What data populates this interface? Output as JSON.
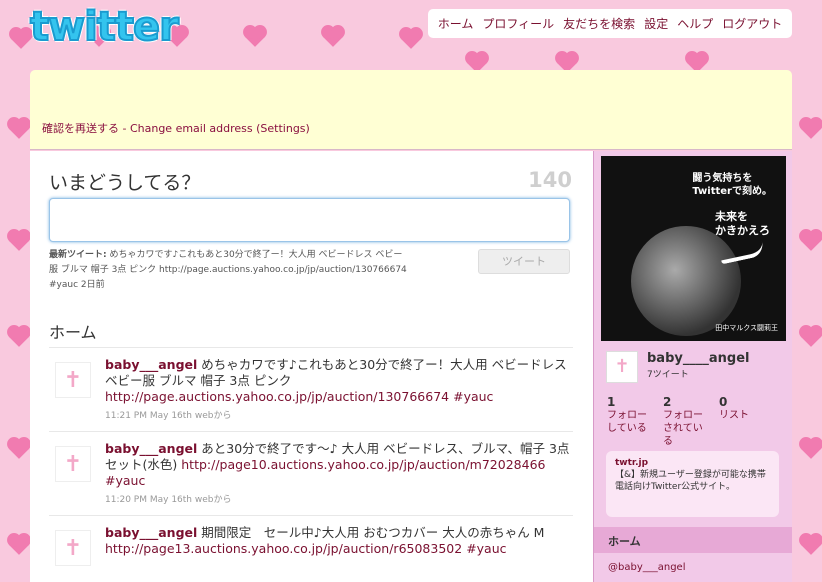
{
  "brand": {
    "logo_text": "twitter"
  },
  "topnav": [
    "ホーム",
    "プロフィール",
    "友だちを検索",
    "設定",
    "ヘルプ",
    "ログアウト"
  ],
  "notice": {
    "text": "確認を再送する - Change email address (Settings)"
  },
  "composer": {
    "prompt": "いまどうしてる？",
    "char_count": "140",
    "input_value": "",
    "latest_label": "最新ツイート:",
    "latest_text": "めちゃカワです♪これもあと30分で終了ー！大人用 ベビードレス ベビー服 ブルマ 帽子 3点 ピンク http://page.auctions.yahoo.co.jp/jp/auction/130766674 #yauc",
    "latest_time": "2日前",
    "tweet_button": "ツイート"
  },
  "timeline_title": "ホーム",
  "timeline": [
    {
      "user": "baby___angel",
      "text": "めちゃカワです♪これもあと30分で終了ー！大人用 ベビードレス ベビー服 ブルマ 帽子 3点 ピンク",
      "link": "http://page.auctions.yahoo.co.jp/jp/auction/130766674",
      "tag": "#yauc",
      "meta": "11:21 PM May 16th webから"
    },
    {
      "user": "baby___angel",
      "text": "あと30分で終了です〜♪ 大人用 ベビードレス、ブルマ、帽子 3点セット(水色)",
      "link": "http://page10.auctions.yahoo.co.jp/jp/auction/m72028466",
      "tag": "#yauc",
      "meta": "11:20 PM May 16th webから"
    },
    {
      "user": "baby___angel",
      "text": "期間限定　セール中♪大人用 おむつカバー 大人の赤ちゃん M",
      "link": "http://page13.auctions.yahoo.co.jp/jp/auction/r65083502",
      "tag": "#yauc",
      "meta": ""
    }
  ],
  "ad": {
    "line1": "闘う気持ちを",
    "line2": "Twitterで刻め。",
    "line3": "未来を",
    "line4": "かきかえろ",
    "caption": "田中マルクス闘莉王"
  },
  "profile": {
    "name": "baby____angel",
    "tweet_count": "7ツイート"
  },
  "stats": [
    {
      "num": "1",
      "label": "フォロー している"
    },
    {
      "num": "2",
      "label": "フォロー されている"
    },
    {
      "num": "0",
      "label": "リスト"
    }
  ],
  "promo": {
    "title": "twtr.jp",
    "body": "【&】新規ユーザー登録が可能な携帯電話向けTwitter公式サイト。"
  },
  "sidebar_home": "ホーム",
  "sidebar_link": "@baby___angel",
  "colors": {
    "accent": "#7a1030",
    "background": "#f9c9de",
    "sidebar": "#f2c9e8"
  }
}
